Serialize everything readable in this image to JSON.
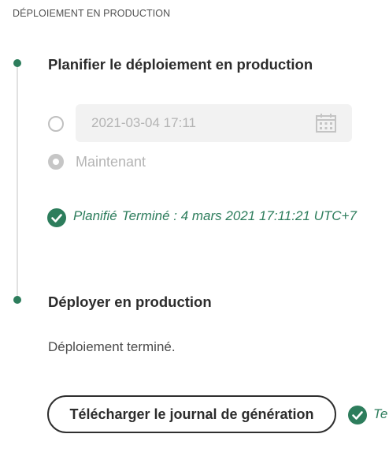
{
  "section": {
    "header": "DÉPLOIEMENT EN PRODUCTION"
  },
  "steps": [
    {
      "title": "Planifier le déploiement en production",
      "date_field": {
        "value": "2021-03-04 17:11",
        "icon": "calendar-icon"
      },
      "radio_options": [
        {
          "label": "",
          "selected": false
        },
        {
          "label": "Maintenant",
          "selected": true
        }
      ],
      "status": {
        "label": "Planifié",
        "detail": "Terminé : 4 mars 2021 17:11:21 UTC+7",
        "icon": "check-circle-icon"
      }
    },
    {
      "title": "Déployer en production",
      "message": "Déploiement terminé.",
      "download_button_label": "Télécharger le journal de génération",
      "trailing_status": "Te"
    }
  ],
  "colors": {
    "success": "#2d7d5c",
    "dot": "#2d7d5c",
    "timeline": "#e1e1e1",
    "disabled_text": "#b4b4b4"
  }
}
